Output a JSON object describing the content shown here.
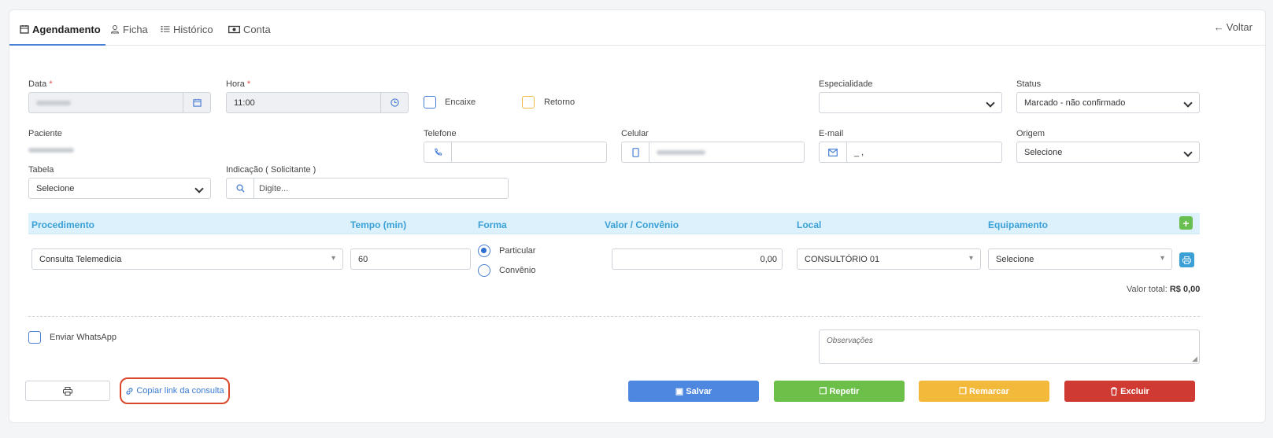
{
  "tabs": [
    {
      "label": "Agendamento",
      "icon": "calendar-icon"
    },
    {
      "label": "Ficha",
      "icon": "user-icon"
    },
    {
      "label": "Histórico",
      "icon": "list-icon"
    },
    {
      "label": "Conta",
      "icon": "money-icon"
    }
  ],
  "back_label": "Voltar",
  "form": {
    "data_label": "Data",
    "hora_label": "Hora",
    "hora_value": "11:00",
    "encaixe_label": "Encaixe",
    "retorno_label": "Retorno",
    "especialidade_label": "Especialidade",
    "especialidade_value": "",
    "status_label": "Status",
    "status_value": "Marcado - não confirmado",
    "paciente_label": "Paciente",
    "telefone_label": "Telefone",
    "celular_label": "Celular",
    "email_label": "E-mail",
    "email_value": "_ ,",
    "origem_label": "Origem",
    "origem_value": "Selecione",
    "tabela_label": "Tabela",
    "tabela_value": "Selecione",
    "indicacao_label": "Indicação ( Solicitante )",
    "indicacao_placeholder": "Digite..."
  },
  "procedures": {
    "headers": [
      "Procedimento",
      "Tempo (min)",
      "Forma",
      "Valor / Convênio",
      "Local",
      "Equipamento"
    ],
    "row": {
      "procedimento": "Consulta Telemedicia",
      "tempo": "60",
      "forma_particular": "Particular",
      "forma_convenio": "Convênio",
      "valor": "0,00",
      "local": "CONSULTÓRIO 01",
      "equipamento": "Selecione"
    },
    "total_label": "Valor total:",
    "total_value": "R$ 0,00"
  },
  "whatsapp_label": "Enviar WhatsApp",
  "observacoes_placeholder": "Observações",
  "copy_link_label": "Copiar link da consulta",
  "buttons": {
    "salvar": "Salvar",
    "repetir": "Repetir",
    "remarcar": "Remarcar",
    "excluir": "Excluir"
  },
  "colors": {
    "accent": "#4a7fd6",
    "salvar": "#4e87e0",
    "repetir": "#6cc04a",
    "remarcar": "#f2b93b",
    "excluir": "#cf3a32",
    "highlight": "#d9472b"
  }
}
